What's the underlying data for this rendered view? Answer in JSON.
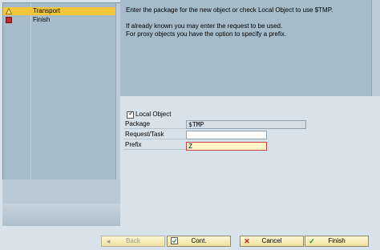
{
  "steps": [
    {
      "label": "Transport",
      "icon": "warning-icon",
      "active": true
    },
    {
      "label": "Finish",
      "icon": "stop-icon",
      "active": false
    }
  ],
  "message": {
    "line1": "Enter the package for the new object or check Local Object to use $TMP.",
    "line2": "If already known you may enter the request to be used.",
    "line3": "For proxy objects you have the option to specify a prefix."
  },
  "form": {
    "local_object_label": "Local Object",
    "local_object_checked": true,
    "package_label": "Package",
    "package_value": "$TMP",
    "request_label": "Request/Task",
    "request_value": "",
    "prefix_label": "Prefix",
    "prefix_value": "Z"
  },
  "buttons": {
    "back": "Back",
    "cont": "Cont.",
    "cancel": "Cancel",
    "finish": "Finish"
  },
  "colors": {
    "active_step": "#f5c63c",
    "panel": "#a6bccb",
    "background": "#d8e2ea"
  }
}
